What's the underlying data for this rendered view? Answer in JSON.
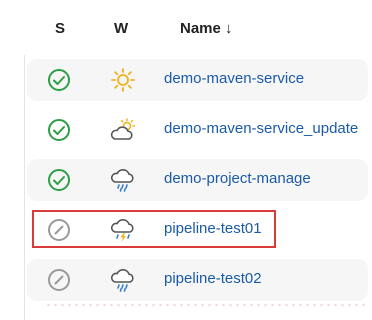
{
  "header": {
    "status_col": "S",
    "weather_col": "W",
    "name_col": "Name ↓"
  },
  "jobs": [
    {
      "name": "demo-maven-service",
      "status": "success",
      "status_icon": "check-circle-icon",
      "weather_icon": "sun-icon"
    },
    {
      "name": "demo-maven-service_update",
      "status": "success",
      "status_icon": "check-circle-icon",
      "weather_icon": "partly-cloudy-icon"
    },
    {
      "name": "demo-project-manage",
      "status": "success",
      "status_icon": "check-circle-icon",
      "weather_icon": "rain-cloud-icon"
    },
    {
      "name": "pipeline-test01",
      "status": "not-built",
      "status_icon": "disabled-circle-icon",
      "weather_icon": "storm-cloud-icon",
      "highlighted": true
    },
    {
      "name": "pipeline-test02",
      "status": "not-built",
      "status_icon": "disabled-circle-icon",
      "weather_icon": "rain-cloud-icon"
    }
  ],
  "colors": {
    "success": "#2e9e47",
    "not_built": "#9a9a9a",
    "link": "#1a5aa8",
    "highlight_border": "#d93a3a",
    "sun": "#f2b21b"
  }
}
